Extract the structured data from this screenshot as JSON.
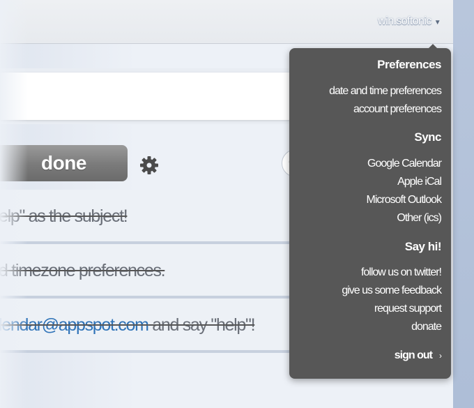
{
  "header": {
    "username": "win.softonic"
  },
  "toolbar": {
    "done_label": "done"
  },
  "tasks": [
    {
      "text_before": "elp\" as the subject!",
      "link": "",
      "text_after": ""
    },
    {
      "text_before": "d timezone preferences.",
      "link": "",
      "text_after": ""
    },
    {
      "text_before": "",
      "link": "lendar@appspot.com",
      "text_after": " and say \"help\"!"
    }
  ],
  "menu": {
    "preferences": {
      "heading": "Preferences",
      "items": [
        "date and time preferences",
        "account preferences"
      ]
    },
    "sync": {
      "heading": "Sync",
      "items": [
        "Google Calendar",
        "Apple iCal",
        "Microsoft Outlook",
        "Other (ics)"
      ]
    },
    "say_hi": {
      "heading": "Say hi!",
      "items": [
        "follow us on twitter!",
        "give us some feedback",
        "request support",
        "donate"
      ]
    },
    "sign_out": "sign out"
  },
  "icons": {
    "caret": "caret-down-icon",
    "gear": "gear-icon",
    "search": "search-icon",
    "chevron": "chevron-right-icon"
  }
}
